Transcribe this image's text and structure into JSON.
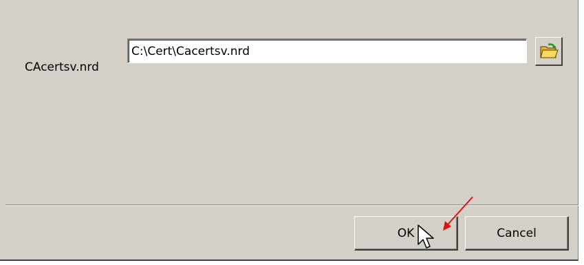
{
  "file": {
    "label": "CAcertsv.nrd",
    "path_value": "C:\\Cert\\Cacertsv.nrd"
  },
  "icons": {
    "browse": "open-folder-icon",
    "cursor": "mouse-pointer-icon",
    "annotation": "red-arrow-icon"
  },
  "buttons": {
    "ok_label": "OK",
    "cancel_label": "Cancel"
  },
  "colors": {
    "dialog_background": "#d4d0c8",
    "annotation_arrow": "#e01010",
    "folder_yellow": "#f0c040",
    "folder_arrow_green": "#1a9a1a"
  }
}
